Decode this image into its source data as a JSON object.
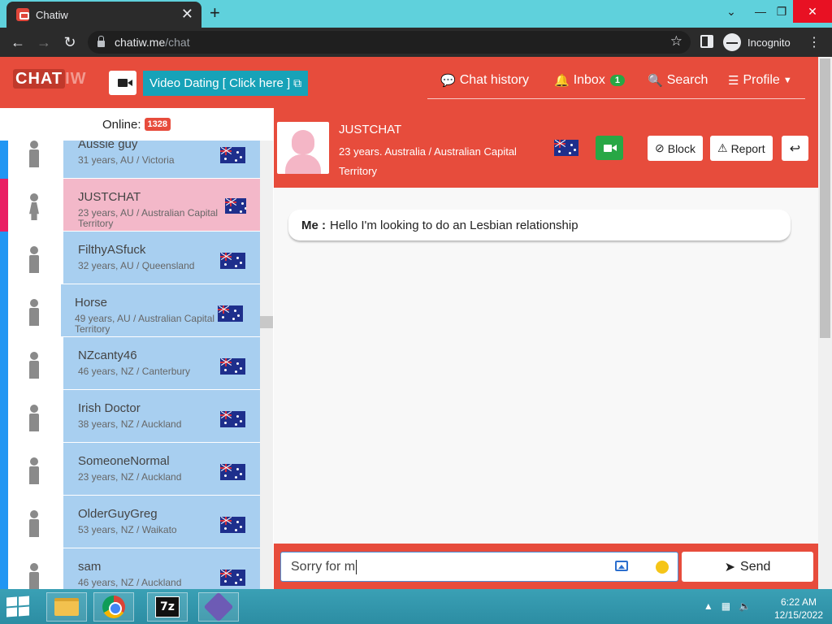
{
  "browser": {
    "tab_title": "Chatiw",
    "url_host": "chatiw.me",
    "url_path": "/chat",
    "incognito_label": "Incognito",
    "tab_close_glyph": "✕",
    "new_tab_glyph": "+"
  },
  "header": {
    "logo_chat": "CHAT",
    "logo_iw": "IW",
    "video_dating_label": "Video Dating [ Click here ]",
    "nav": {
      "chat_history": "Chat history",
      "inbox": "Inbox",
      "inbox_count": "1",
      "search": "Search",
      "profile": "Profile"
    }
  },
  "sidebar": {
    "online_label": "Online:",
    "online_count": "1328",
    "users": [
      {
        "name": "Aussie guy",
        "info": "31 years, AU / Victoria",
        "gender": "male"
      },
      {
        "name": "JUSTCHAT",
        "info": "23 years, AU / Australian Capital Territory",
        "gender": "female"
      },
      {
        "name": "FilthyASfuck",
        "info": "32 years, AU / Queensland",
        "gender": "male"
      },
      {
        "name": "Horse",
        "info": "49 years, AU / Australian Capital Territory",
        "gender": "male"
      },
      {
        "name": "NZcanty46",
        "info": "46 years, NZ / Canterbury",
        "gender": "male"
      },
      {
        "name": "Irish Doctor",
        "info": "38 years, NZ / Auckland",
        "gender": "male"
      },
      {
        "name": "SomeoneNormal",
        "info": "23 years, NZ / Auckland",
        "gender": "male"
      },
      {
        "name": "OlderGuyGreg",
        "info": "53 years, NZ / Waikato",
        "gender": "male"
      },
      {
        "name": "sam",
        "info": "46 years, NZ / Auckland",
        "gender": "male"
      }
    ]
  },
  "chat": {
    "partner_name": "JUSTCHAT",
    "partner_info": "23 years. Australia / Australian Capital Territory",
    "block_label": "Block",
    "report_label": "Report",
    "messages": [
      {
        "sender": "Me :",
        "text": "Hello I'm looking to do an Lesbian relationship"
      }
    ],
    "input_value": "Sorry for m",
    "send_label": "Send"
  },
  "taskbar": {
    "time": "6:22 AM",
    "date": "12/15/2022",
    "sevenzip_label": "7z"
  },
  "colors": {
    "brand": "#e74c3c",
    "male_card": "#a8cff0",
    "female_card": "#f3b8c9",
    "video_dating": "#17a2b8",
    "video_call": "#28a745"
  }
}
